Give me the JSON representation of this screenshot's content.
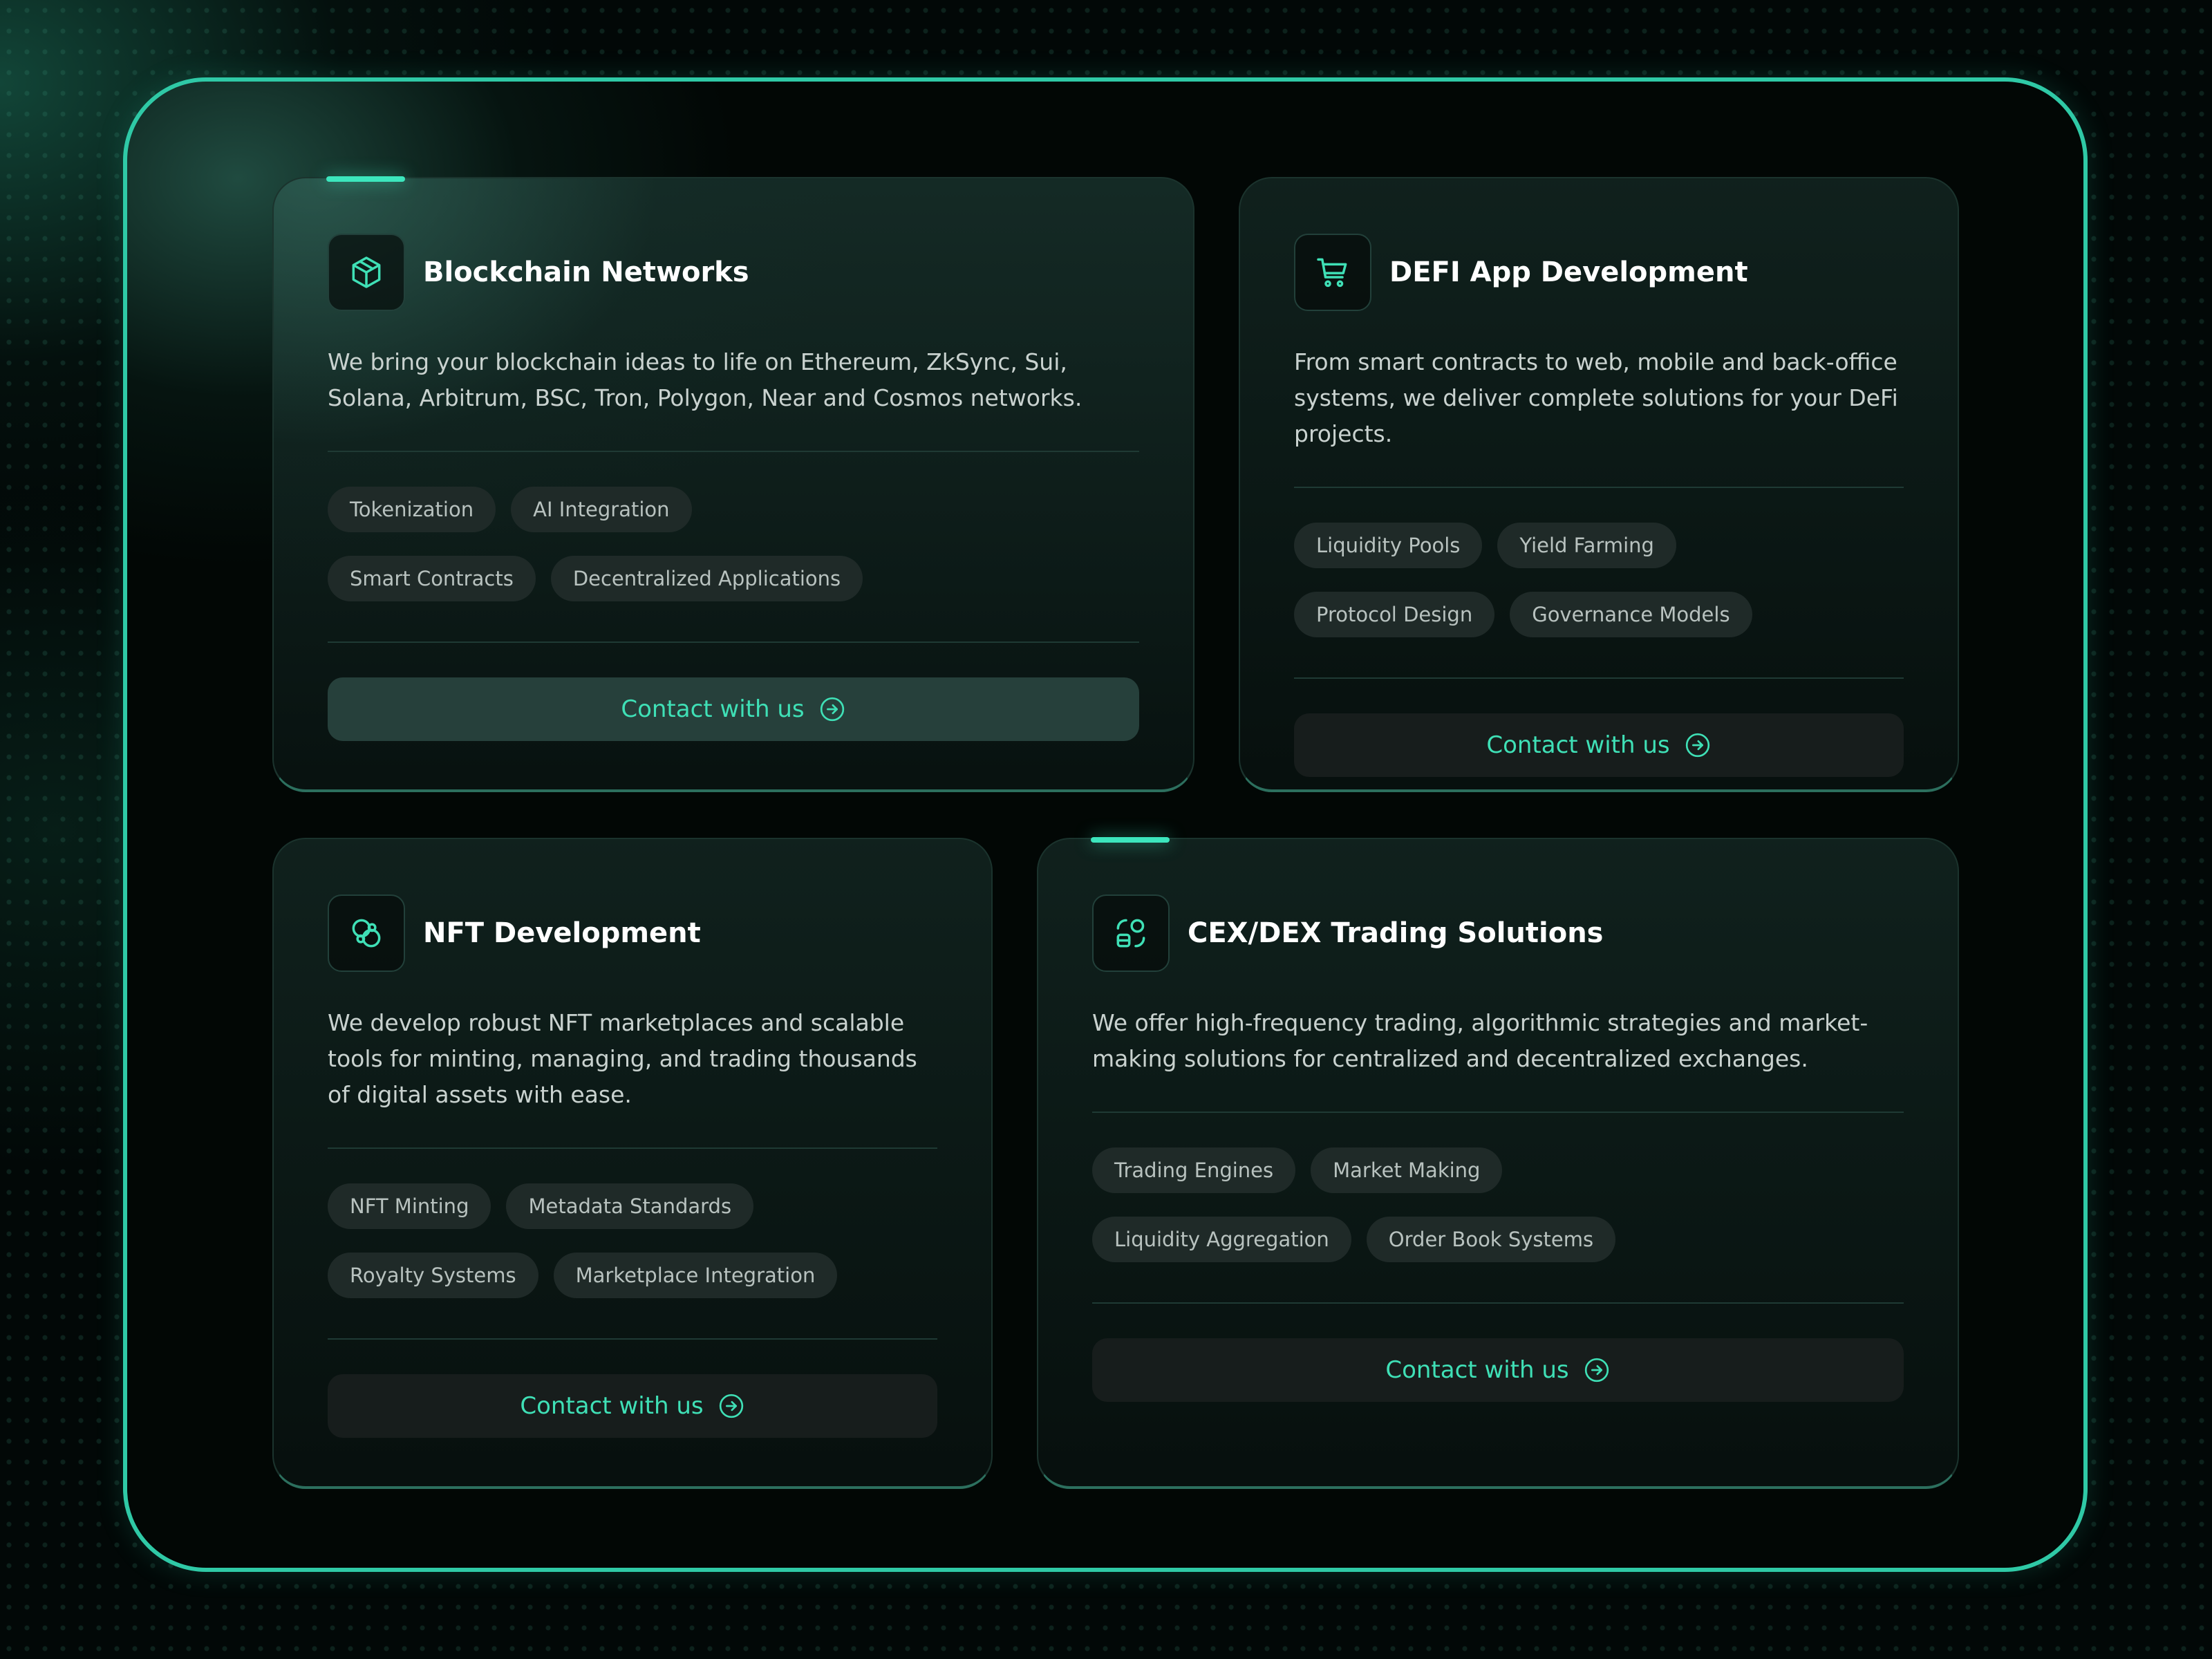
{
  "theme": {
    "accent": "#3fe0b6",
    "frame_border": "#2fc9a6",
    "background": "#020807",
    "tag_background": "#1f2a28"
  },
  "cards": [
    {
      "title": "Blockchain Networks",
      "icon": "cube-icon",
      "description": "We bring your blockchain ideas to life on Ethereum, ZkSync, Sui, Solana, Arbitrum, BSC, Tron, Polygon, Near and Cosmos networks.",
      "tags": [
        "Tokenization",
        "AI Integration",
        "Smart Contracts",
        "Decentralized Applications"
      ],
      "button_label": "Contact with us",
      "highlighted": true
    },
    {
      "title": "DEFI App Development",
      "icon": "cart-icon",
      "description": "From smart contracts to web, mobile and back-office systems, we deliver complete solutions for your DeFi projects.",
      "tags": [
        "Liquidity Pools",
        "Yield Farming",
        "Protocol Design",
        "Governance Models"
      ],
      "button_label": "Contact with us",
      "highlighted": false
    },
    {
      "title": "NFT Development",
      "icon": "overlapping-circles-icon",
      "description": "We develop robust NFT marketplaces and scalable tools for minting, managing, and trading thousands of digital assets with ease.",
      "tags": [
        "NFT Minting",
        "Metadata Standards",
        "Royalty Systems",
        "Marketplace Integration"
      ],
      "button_label": "Contact with us",
      "highlighted": false
    },
    {
      "title": "CEX/DEX Trading Solutions",
      "icon": "exchange-icon",
      "description": "We offer high-frequency trading, algorithmic strategies and market-making solutions for centralized and decentralized exchanges.",
      "tags": [
        "Trading Engines",
        "Market Making",
        "Liquidity Aggregation",
        "Order Book Systems"
      ],
      "button_label": "Contact with us",
      "highlighted": false
    }
  ]
}
